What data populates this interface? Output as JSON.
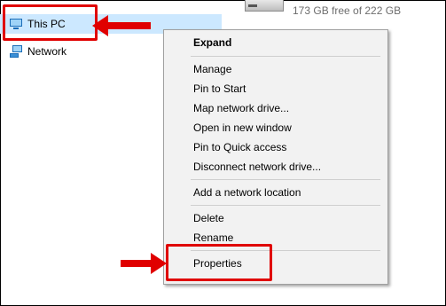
{
  "nav": {
    "this_pc": {
      "label": "This PC",
      "icon": "computer-icon"
    },
    "network": {
      "label": "Network",
      "icon": "network-icon"
    }
  },
  "drive": {
    "free_text": "173 GB free of 222 GB",
    "icon": "drive-icon"
  },
  "context_menu": {
    "items": [
      {
        "label": "Expand",
        "bold": true
      },
      {
        "label": "Manage"
      },
      {
        "label": "Pin to Start"
      },
      {
        "label": "Map network drive..."
      },
      {
        "label": "Open in new window"
      },
      {
        "label": "Pin to Quick access"
      },
      {
        "label": "Disconnect network drive..."
      },
      {
        "label": "Add a network location"
      },
      {
        "label": "Delete"
      },
      {
        "label": "Rename"
      },
      {
        "label": "Properties"
      }
    ]
  },
  "colors": {
    "highlight": "#e00000",
    "selection": "#cce8ff",
    "menu_bg": "#f2f2f2"
  }
}
